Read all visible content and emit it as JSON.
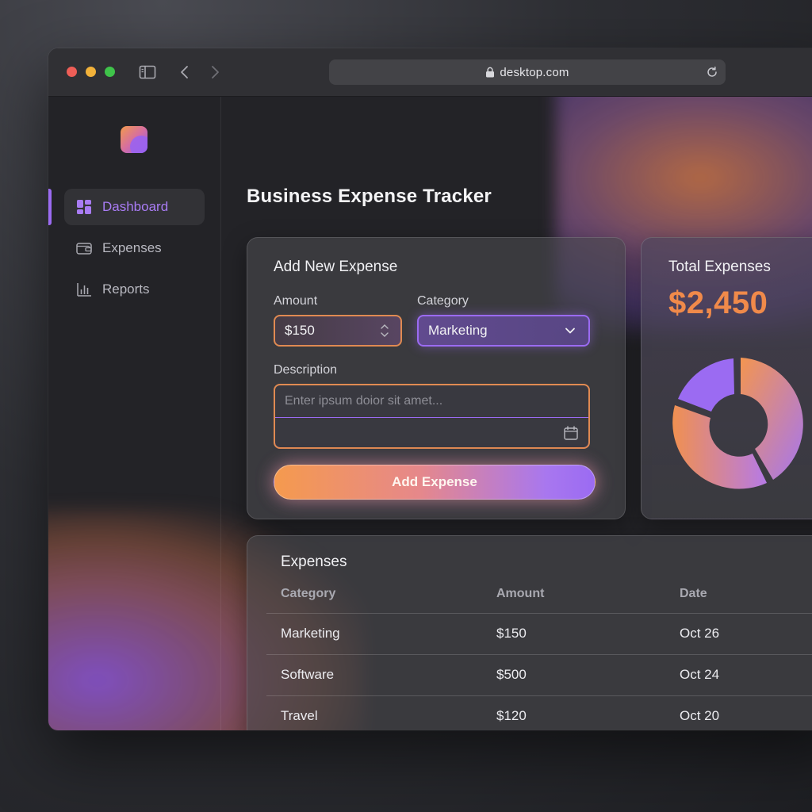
{
  "browser": {
    "url": "desktop.com",
    "icons": {
      "sidebar": "sidebar-toggle-icon",
      "back": "chevron-left-icon",
      "forward": "chevron-right-icon",
      "lock": "lock-icon",
      "reload": "reload-icon"
    }
  },
  "sidebar": {
    "items": [
      {
        "label": "Dashboard",
        "icon": "dashboard-icon",
        "active": true
      },
      {
        "label": "Expenses",
        "icon": "wallet-icon",
        "active": false
      },
      {
        "label": "Reports",
        "icon": "bar-chart-icon",
        "active": false
      }
    ]
  },
  "page": {
    "title": "Business Expense Tracker"
  },
  "form": {
    "title": "Add New Expense",
    "amount_label": "Amount",
    "amount_value": "$150",
    "category_label": "Category",
    "category_value": "Marketing",
    "description_label": "Description",
    "description_placeholder": "Enter ipsum doior sit amet...",
    "submit_label": "Add Expense"
  },
  "total": {
    "title": "Total Expenses",
    "value": "$2,450",
    "accent": "#f08a4a"
  },
  "table": {
    "title": "Expenses",
    "headers": [
      "Category",
      "Amount",
      "Date"
    ],
    "rows": [
      {
        "category": "Marketing",
        "amount": "$150",
        "date": "Oct 26"
      },
      {
        "category": "Software",
        "amount": "$500",
        "date": "Oct 24"
      },
      {
        "category": "Travel",
        "amount": "$120",
        "date": "Oct 20"
      }
    ]
  },
  "colors": {
    "orange": "#f59a4e",
    "purple": "#9b6bf2",
    "background": "#232327"
  }
}
